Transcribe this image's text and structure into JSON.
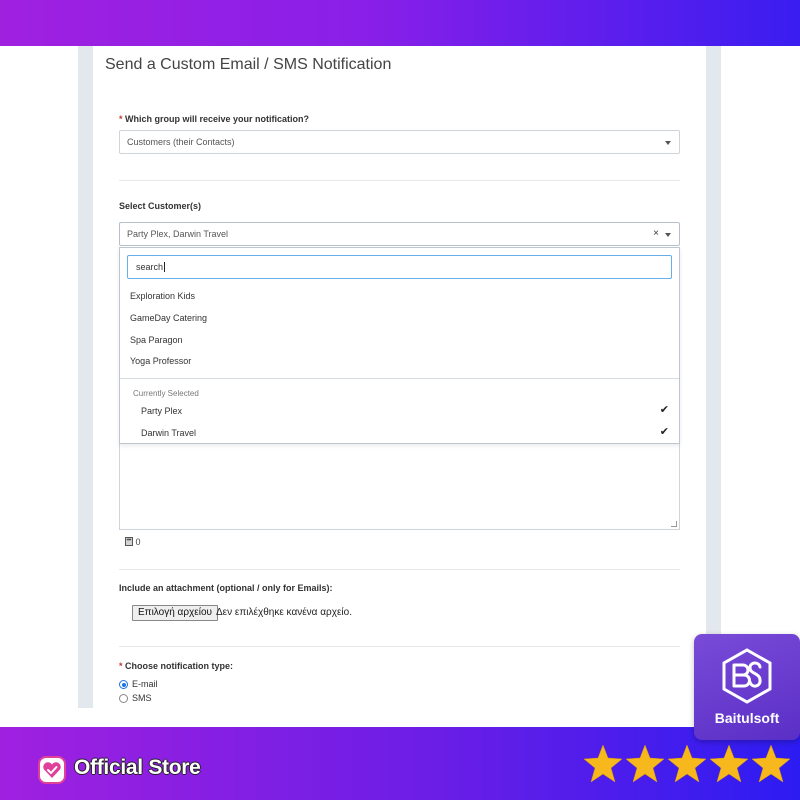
{
  "page": {
    "title": "Send a Custom Email / SMS Notification"
  },
  "group_field": {
    "required_mark": "*",
    "label": "Which group will receive your notification?",
    "value": "Customers (their Contacts)"
  },
  "customer_field": {
    "label": "Select Customer(s)",
    "value": "Party Plex, Darwin Travel",
    "clear_symbol": "×",
    "search": "search",
    "options": [
      "Exploration Kids",
      "GameDay Catering",
      "Spa Paragon",
      "Yoga Professor"
    ],
    "selected_group_label": "Currently Selected",
    "selected": [
      "Party Plex",
      "Darwin Travel"
    ],
    "check_symbol": "✔"
  },
  "message": {
    "char_count": "0"
  },
  "attachment": {
    "label": "Include an attachment (optional / only for Emails):",
    "button_label": "Επιλογή αρχείου",
    "status": "Δεν επιλέχθηκε κανένα αρχείο."
  },
  "notification_type": {
    "required_mark": "*",
    "label": "Choose notification type:",
    "options": [
      "E-mail",
      "SMS"
    ],
    "selected": "E-mail"
  },
  "store": {
    "badge": "Official Store",
    "brand": "Baitulsoft",
    "rating": 5,
    "rating_max": 5
  },
  "colors": {
    "banner_purple": "#a020e0",
    "banner_blue": "#3a1df0",
    "star_gold": "#f6b81c",
    "focus_blue": "#66afe9"
  }
}
